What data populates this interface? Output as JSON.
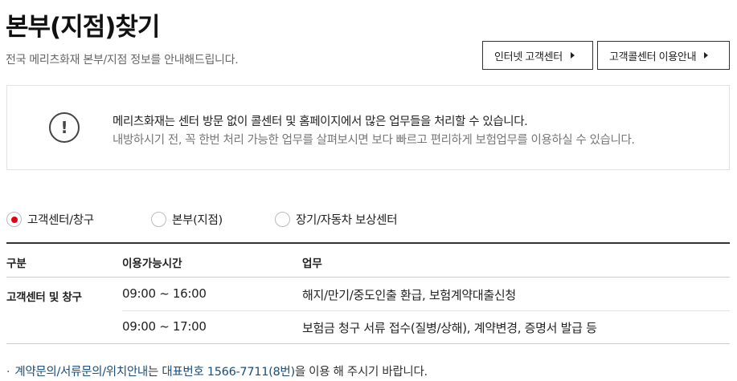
{
  "page": {
    "title": "본부(지점)찾기",
    "subtitle": "전국 메리츠화재 본부/지점 정보를 안내해드립니다."
  },
  "buttons": {
    "internet": "인터넷 고객센터",
    "callcenter": "고객콜센터 이용안내"
  },
  "notice": {
    "icon": "exclamation-circle-icon",
    "line1": "메리츠화재는 센터 방문 없이 콜센터 및 홈페이지에서 많은 업무들을 처리할 수 있습니다.",
    "line2": "내방하시기 전, 꼭 한번 처리 가능한 업무를 살펴보시면 보다 빠르고 편리하게 보험업무를 이용하실 수 있습니다."
  },
  "radios": [
    {
      "label": "고객센터/창구",
      "checked": true
    },
    {
      "label": "본부(지점)",
      "checked": false
    },
    {
      "label": "장기/자동차 보상센터",
      "checked": false
    }
  ],
  "table": {
    "headers": [
      "구분",
      "이용가능시간",
      "업무"
    ],
    "group": "고객센터 및 창구",
    "rows": [
      {
        "time": "09:00 ~ 16:00",
        "work": "해지/만기/중도인출 환급, 보험계약대출신청"
      },
      {
        "time": "09:00 ~ 17:00",
        "work": "보험금 청구 서류 접수(질병/상해), 계약변경, 증명서 발급 등"
      }
    ]
  },
  "footnote": {
    "bullet": "·",
    "hl1": "계약문의/서류문의/위치안내",
    "mid": "는 ",
    "hl2": "대표번호 1566-7711(8번)",
    "tail": "을 이용 해 주시기 바랍니다."
  },
  "colors": {
    "accent": "#e60012",
    "link": "#1a4d7a"
  }
}
